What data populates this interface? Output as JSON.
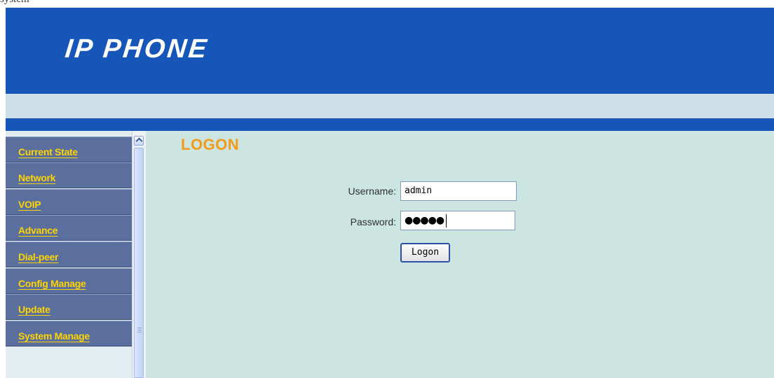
{
  "top_strip_text": "system",
  "header": {
    "logo": "IP PHONE"
  },
  "sidebar": {
    "items": [
      {
        "label": "Current State"
      },
      {
        "label": "Network"
      },
      {
        "label": "VOIP"
      },
      {
        "label": "Advance"
      },
      {
        "label": "Dial-peer"
      },
      {
        "label": "Config Manage"
      },
      {
        "label": "Update"
      },
      {
        "label": "System Manage"
      }
    ]
  },
  "main": {
    "title": "LOGON",
    "form": {
      "username_label": "Username:",
      "username_value": "admin",
      "password_label": "Password:",
      "password_masked": "●●●●●",
      "submit_label": "Logon"
    }
  },
  "colors": {
    "header_blue": "#1656b9",
    "menu_bg": "#5a6f9e",
    "menu_text": "#ffd400",
    "title_orange": "#f29a1a",
    "content_bg": "#cce5e0"
  }
}
